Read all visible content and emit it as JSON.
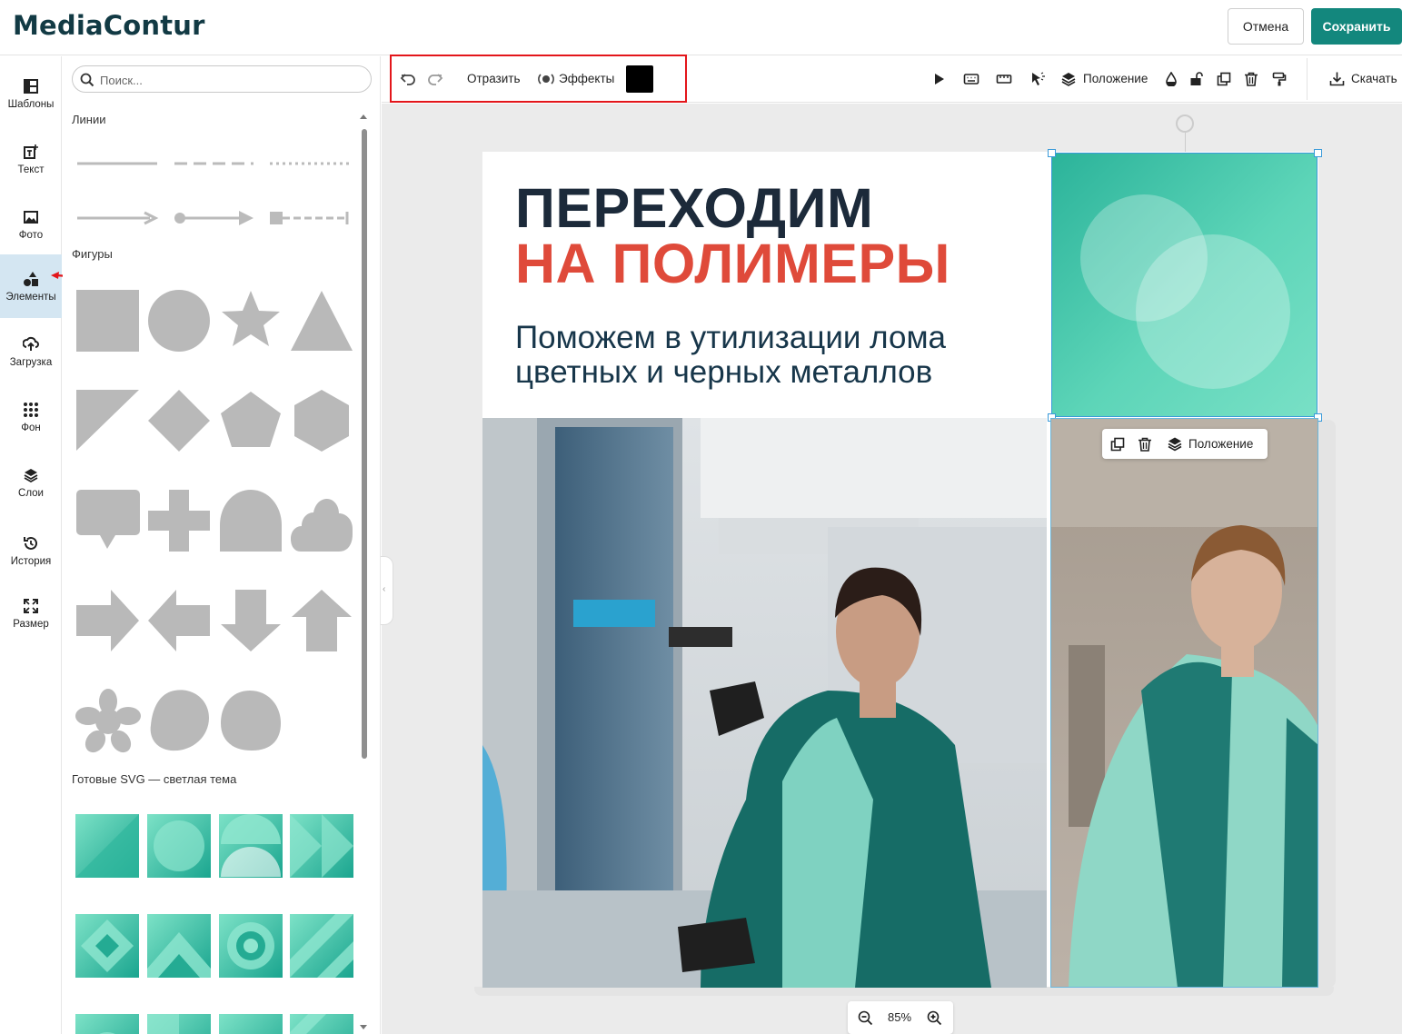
{
  "app": {
    "brand": "MediaContur",
    "cancel_label": "Отмена",
    "save_label": "Сохранить",
    "accent_color": "#13877d"
  },
  "nav": {
    "items": [
      {
        "label": "Шаблоны",
        "icon": "templates-icon"
      },
      {
        "label": "Текст",
        "icon": "text-icon"
      },
      {
        "label": "Фото",
        "icon": "photo-icon"
      },
      {
        "label": "Элементы",
        "icon": "elements-icon",
        "active": true
      },
      {
        "label": "Загрузка",
        "icon": "upload-icon"
      },
      {
        "label": "Фон",
        "icon": "background-icon"
      },
      {
        "label": "Слои",
        "icon": "layers-icon"
      },
      {
        "label": "История",
        "icon": "history-icon"
      },
      {
        "label": "Размер",
        "icon": "resize-icon"
      }
    ]
  },
  "panel": {
    "search_placeholder": "Поиск...",
    "sections": {
      "lines": "Линии",
      "shapes": "Фигуры",
      "svg_light": "Готовые SVG — светлая тема"
    }
  },
  "toolbar": {
    "flip_label": "Отразить",
    "effects_label": "Эффекты",
    "color_value": "#000000",
    "position_label": "Положение",
    "download_label": "Скачать"
  },
  "canvas": {
    "headline_line1": "ПЕРЕХОДИМ",
    "headline_line2": "НА ПОЛИМЕРЫ",
    "subtitle_line1": "Поможем в утилизации лома",
    "subtitle_line2": "цветных и черных металлов",
    "float_position_label": "Положение",
    "zoom": "85%",
    "headline_color": "#1c2a3a",
    "headline_accent_color": "#df4a3a"
  }
}
